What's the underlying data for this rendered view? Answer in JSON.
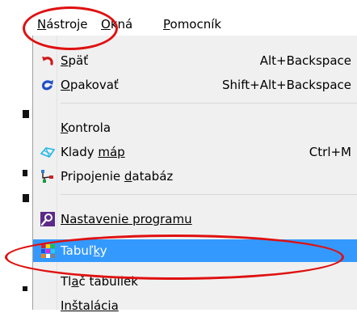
{
  "menubar": {
    "items": [
      {
        "label_before": "",
        "label_ul": "N",
        "label_after": "ástroje"
      },
      {
        "label_before": "",
        "label_ul": "O",
        "label_after": "kná"
      },
      {
        "label_before": "",
        "label_ul": "P",
        "label_after": "omocník"
      }
    ]
  },
  "menu": {
    "items": [
      {
        "icon": "undo-icon",
        "label_before": "",
        "label_ul": "S",
        "label_after": "päť",
        "shortcut": "Alt+Backspace"
      },
      {
        "icon": "redo-icon",
        "label_before": "",
        "label_ul": "O",
        "label_after": "pakovať",
        "shortcut": "Shift+Alt+Backspace"
      },
      {
        "icon": "",
        "label_before": "",
        "label_ul": "K",
        "label_after": "ontrola",
        "shortcut": ""
      },
      {
        "icon": "map-sheets-icon",
        "label_before": "Klady ",
        "label_ul": "máp",
        "label_after": "",
        "shortcut": "Ctrl+M"
      },
      {
        "icon": "database-connection-icon",
        "label_before": "Pripojenie ",
        "label_ul": "d",
        "label_after": "atabáz",
        "shortcut": ""
      },
      {
        "icon": "settings-magnifier-icon",
        "label_before": "",
        "label_ul": "Nastavenie programu",
        "label_after": "",
        "shortcut": ""
      },
      {
        "icon": "table-grid-icon",
        "label_before": "Tabuľ",
        "label_ul": "k",
        "label_after": "y",
        "shortcut": ""
      },
      {
        "icon": "",
        "label_before": "Tl",
        "label_ul": "a",
        "label_after": "č tabuliek",
        "shortcut": ""
      },
      {
        "icon": "",
        "label_before": "Inštalácia",
        "label_ul": "",
        "label_after": "",
        "shortcut": ""
      }
    ],
    "selected_index": 6
  },
  "colors": {
    "selection": "#3399ff",
    "highlight_ellipse": "#e01010",
    "menu_background": "#f0f0f0"
  }
}
